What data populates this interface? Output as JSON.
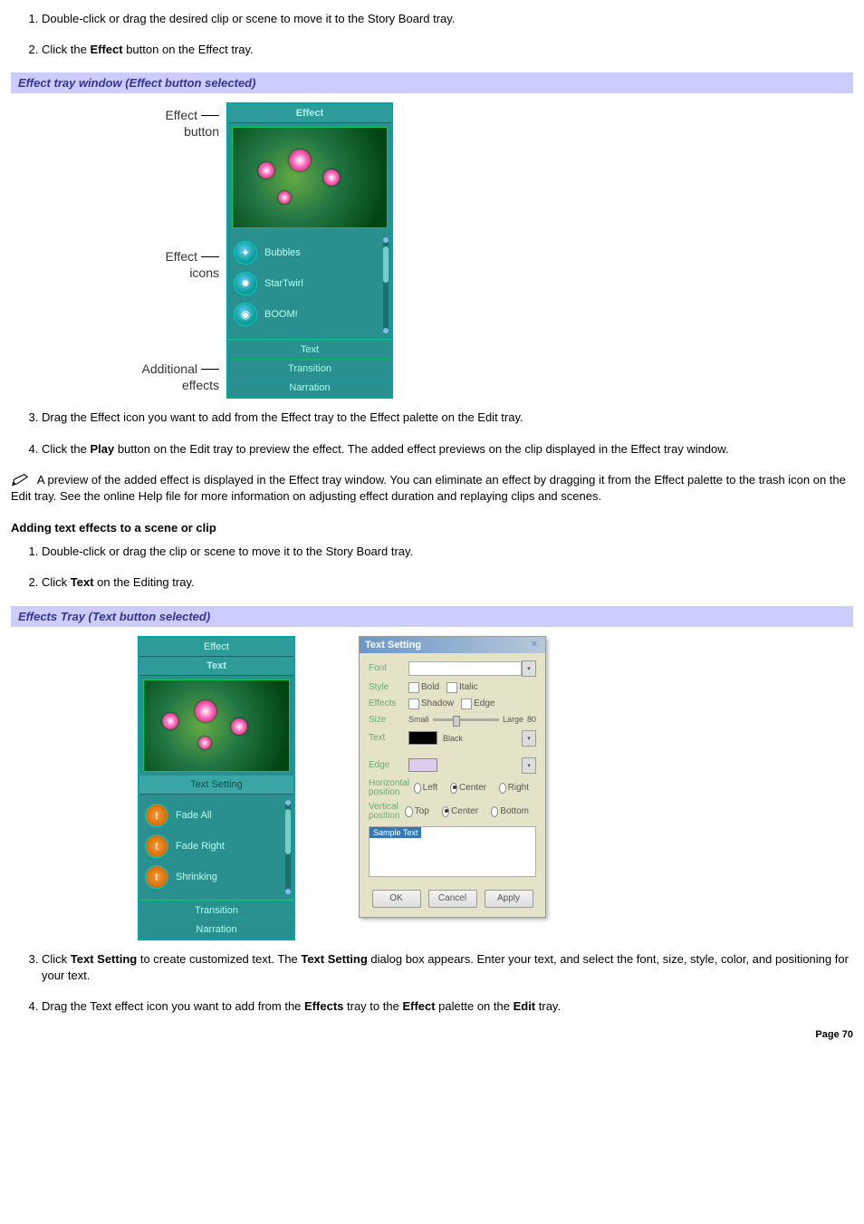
{
  "list1": {
    "item1_a": "Double-click or drag the desired clip or scene to move it to the Story Board tray.",
    "item2_a": "Click the ",
    "item2_b": "Effect",
    "item2_c": " button on the Effect tray."
  },
  "section1_title": "Effect tray window (Effect button selected)",
  "fig1_labels": {
    "effect_button_l1": "Effect",
    "effect_button_l2": "button",
    "effect_icons_l1": "Effect",
    "effect_icons_l2": "icons",
    "additional_l1": "Additional",
    "additional_l2": "effects"
  },
  "tray1": {
    "tab_effect": "Effect",
    "items": [
      "Bubbles",
      "StarTwirl",
      "BOOM!"
    ],
    "icons": [
      "✦",
      "✹",
      "◉"
    ],
    "bottom": [
      "Text",
      "Transition",
      "Narration"
    ]
  },
  "list2": {
    "item3_a": "Drag the Effect icon you want to add from the Effect tray to the Effect palette on the Edit tray.",
    "item4_a": "Click the ",
    "item4_b": "Play",
    "item4_c": " button on the Edit tray to preview the effect. The added effect previews on the clip displayed in the Effect tray window."
  },
  "note1": " A preview of the added effect is displayed in the Effect tray window. You can eliminate an effect by dragging it from the Effect palette to the trash icon on the Edit tray. See the online Help file for more information on adjusting effect duration and replaying clips and scenes.",
  "subhead": "Adding text effects to a scene or clip",
  "list3": {
    "item1_a": "Double-click or drag the clip or scene to move it to the Story Board tray.",
    "item2_a": "Click ",
    "item2_b": "Text",
    "item2_c": " on the Editing tray."
  },
  "section2_title": "Effects Tray (Text button selected)",
  "tray2": {
    "tab_effect": "Effect",
    "tab_text": "Text",
    "text_setting_btn": "Text Setting",
    "items": [
      "Fade All",
      "Fade Right",
      "Shrinking"
    ],
    "bottom": [
      "Transition",
      "Narration"
    ]
  },
  "dlg": {
    "title": "Text Setting",
    "close": "×",
    "font_label": "Font",
    "style_label": "Style",
    "bold": "Bold",
    "italic": "Italic",
    "effects_label": "Effects",
    "shadow": "Shadow",
    "edge": "Edge",
    "size_label": "Size",
    "size_small": "Small",
    "size_large": "Large",
    "size_value": "80",
    "text_label": "Text",
    "text_color": "Black",
    "edge_label": "Edge",
    "hpos_label1": "Horizontal",
    "hpos_label2": "position",
    "hpos_left": "Left",
    "hpos_center": "Center",
    "hpos_right": "Right",
    "vpos_label1": "Vertical",
    "vpos_label2": "position",
    "vpos_top": "Top",
    "vpos_center": "Center",
    "vpos_bottom": "Bottom",
    "sample": "Sample Text",
    "ok": "OK",
    "cancel": "Cancel",
    "apply": "Apply"
  },
  "list4": {
    "item3_a": "Click ",
    "item3_b": "Text Setting",
    "item3_c": " to create customized text. The ",
    "item3_d": "Text Setting",
    "item3_e": " dialog box appears. Enter your text, and select the font, size, style, color, and positioning for your text.",
    "item4_a": "Drag the Text effect icon you want to add from the ",
    "item4_b": "Effects",
    "item4_c": " tray to the ",
    "item4_d": "Effect",
    "item4_e": " palette on the ",
    "item4_f": "Edit",
    "item4_g": " tray."
  },
  "page_number": "Page 70"
}
